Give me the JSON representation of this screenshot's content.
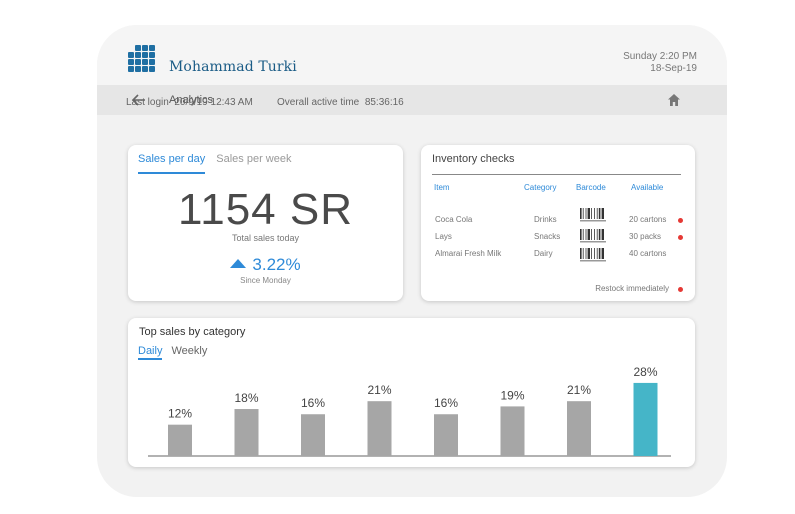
{
  "header": {
    "user_name": "Mohammad Turki",
    "date_line1": "Sunday 2:20 PM",
    "date_line2": "18-Sep-19"
  },
  "nav": {
    "title": "Analytics",
    "back_icon": "arrow-left-icon",
    "home_icon": "home-icon"
  },
  "meta": {
    "last_login_label": "Last login",
    "last_login_value": "20/9/19 12:43 AM",
    "active_time_label": "Overall active time",
    "active_time_value": "85:36:16"
  },
  "sales": {
    "tabs": [
      "Sales per day",
      "Sales per week"
    ],
    "total": "1154 SR",
    "total_caption": "Total sales today",
    "growth": "3.22%",
    "since": "Since Monday"
  },
  "inventory": {
    "title": "Inventory checks",
    "columns": [
      "Item",
      "Category",
      "Barcode",
      "Available"
    ],
    "rows": [
      {
        "item": "Coca Cola",
        "category": "Drinks",
        "available": "20 cartons",
        "alert": true
      },
      {
        "item": "Lays",
        "category": "Snacks",
        "available": "30 packs",
        "alert": true
      },
      {
        "item": "Almarai Fresh Milk",
        "category": "Dairy",
        "available": "40 cartons",
        "alert": false
      }
    ],
    "restock_label": "Restock immediately"
  },
  "top_sales": {
    "title": "Top sales by category",
    "tabs": [
      "Daily",
      "Weekly"
    ]
  },
  "colors": {
    "accent": "#2e8ad8",
    "brand": "#1f6fa3",
    "bar": "#a6a6a6",
    "bar_highlight": "#45b5c8",
    "alert": "#e53935"
  },
  "chart_data": {
    "type": "bar",
    "title": "Top sales by category",
    "categories": [
      "",
      "",
      "",
      "",
      "",
      "",
      "",
      ""
    ],
    "values": [
      12,
      18,
      16,
      21,
      16,
      19,
      21,
      28
    ],
    "labels": [
      "12%",
      "18%",
      "16%",
      "21%",
      "16%",
      "19%",
      "21%",
      "28%"
    ],
    "highlight_index": 7,
    "ylim": [
      0,
      30
    ],
    "grid": false
  }
}
